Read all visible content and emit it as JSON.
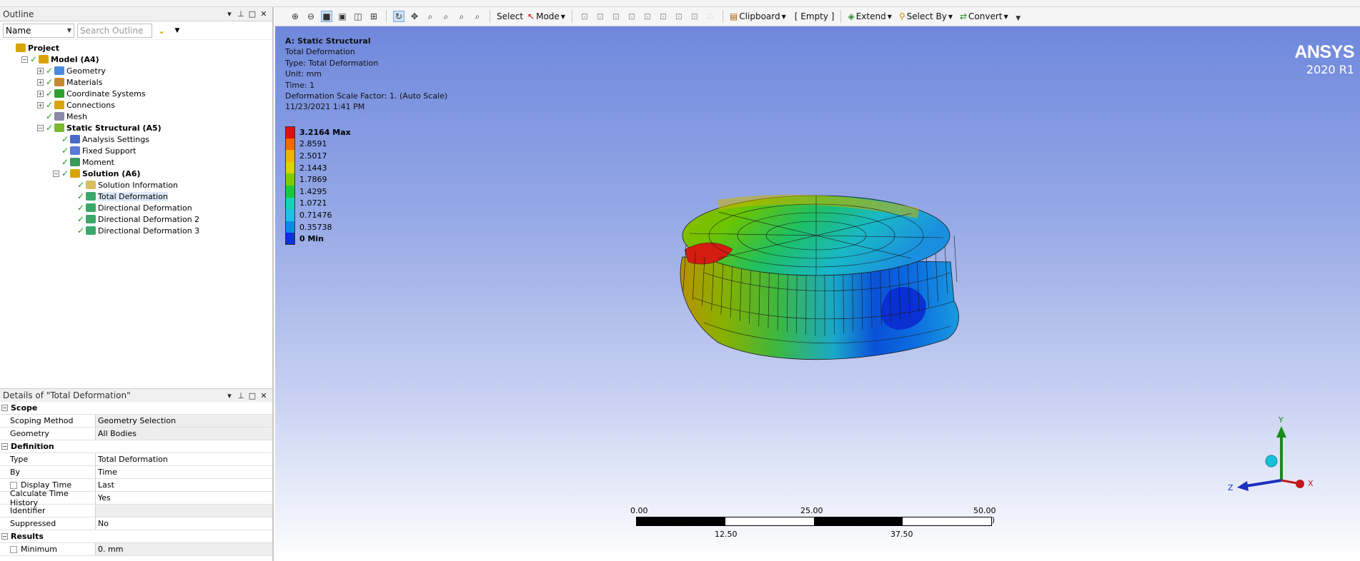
{
  "outline": {
    "title": "Outline",
    "filter_combo": "Name",
    "search_placeholder": "Search Outline",
    "tree": [
      {
        "label": "Project",
        "level": 0,
        "bold": true,
        "icon": "project-icon"
      },
      {
        "label": "Model (A4)",
        "level": 1,
        "bold": true,
        "icon": "model-icon"
      },
      {
        "label": "Geometry",
        "level": 2,
        "icon": "geometry-icon"
      },
      {
        "label": "Materials",
        "level": 2,
        "icon": "materials-icon"
      },
      {
        "label": "Coordinate Systems",
        "level": 2,
        "icon": "coordinate-systems-icon"
      },
      {
        "label": "Connections",
        "level": 2,
        "icon": "connections-icon"
      },
      {
        "label": "Mesh",
        "level": 2,
        "icon": "mesh-icon"
      },
      {
        "label": "Static Structural (A5)",
        "level": 2,
        "bold": true,
        "icon": "static-structural-icon"
      },
      {
        "label": "Analysis Settings",
        "level": 3,
        "icon": "analysis-settings-icon"
      },
      {
        "label": "Fixed Support",
        "level": 3,
        "icon": "fixed-support-icon"
      },
      {
        "label": "Moment",
        "level": 3,
        "icon": "moment-icon"
      },
      {
        "label": "Solution (A6)",
        "level": 3,
        "bold": true,
        "icon": "solution-icon"
      },
      {
        "label": "Solution Information",
        "level": 4,
        "icon": "solution-information-icon"
      },
      {
        "label": "Total Deformation",
        "level": 4,
        "icon": "total-deformation-icon",
        "selected": true
      },
      {
        "label": "Directional Deformation",
        "level": 4,
        "icon": "directional-deformation-icon"
      },
      {
        "label": "Directional Deformation 2",
        "level": 4,
        "icon": "directional-deformation-icon"
      },
      {
        "label": "Directional Deformation 3",
        "level": 4,
        "icon": "directional-deformation-icon"
      }
    ]
  },
  "details": {
    "title": "Details of \"Total Deformation\"",
    "scope": "Scope",
    "scoping_method_label": "Scoping Method",
    "scoping_method_value": "Geometry Selection",
    "geometry_label": "Geometry",
    "geometry_value": "All Bodies",
    "definition": "Definition",
    "type_label": "Type",
    "type_value": "Total Deformation",
    "by_label": "By",
    "by_value": "Time",
    "display_time_label": "Display Time",
    "display_time_value": "Last",
    "calc_hist_label": "Calculate Time History",
    "calc_hist_value": "Yes",
    "identifier_label": "Identifier",
    "identifier_value": "",
    "suppressed_label": "Suppressed",
    "suppressed_value": "No",
    "results": "Results",
    "minimum_label": "Minimum",
    "minimum_value": "0. mm"
  },
  "toolbar": {
    "select": "Select",
    "mode": "Mode",
    "clipboard": "Clipboard",
    "empty": "[ Empty ]",
    "extend": "Extend",
    "select_by": "Select By",
    "convert": "Convert"
  },
  "viewport": {
    "title": "A: Static Structural",
    "result": "Total Deformation",
    "type_line": "Type: Total Deformation",
    "unit_line": "Unit: mm",
    "time_line": "Time: 1",
    "scale_line": "Deformation Scale Factor: 1. (Auto Scale)",
    "date_line": "11/23/2021 1:41 PM",
    "brand_name": "ANSYS",
    "brand_version": "2020 R1",
    "legend": [
      {
        "label": "3.2164 Max",
        "color": "#e0100e",
        "bold": true
      },
      {
        "label": "2.8591",
        "color": "#f06a00"
      },
      {
        "label": "2.5017",
        "color": "#f0b400"
      },
      {
        "label": "2.1443",
        "color": "#d8d400"
      },
      {
        "label": "1.7869",
        "color": "#7ccc00"
      },
      {
        "label": "1.4295",
        "color": "#19c83c"
      },
      {
        "label": "1.0721",
        "color": "#19d0b4"
      },
      {
        "label": "0.71476",
        "color": "#1ec0e6"
      },
      {
        "label": "0.35738",
        "color": "#0c8ae6"
      },
      {
        "label": "0 Min",
        "color": "#0a30d6",
        "bold": true
      }
    ],
    "scale_bar": {
      "top_labels": [
        "0.00",
        "25.00",
        "50.00 (mm)"
      ],
      "bottom_labels": [
        "12.50",
        "37.50"
      ]
    },
    "triad": {
      "x": "X",
      "y": "Y",
      "z": "Z"
    }
  }
}
